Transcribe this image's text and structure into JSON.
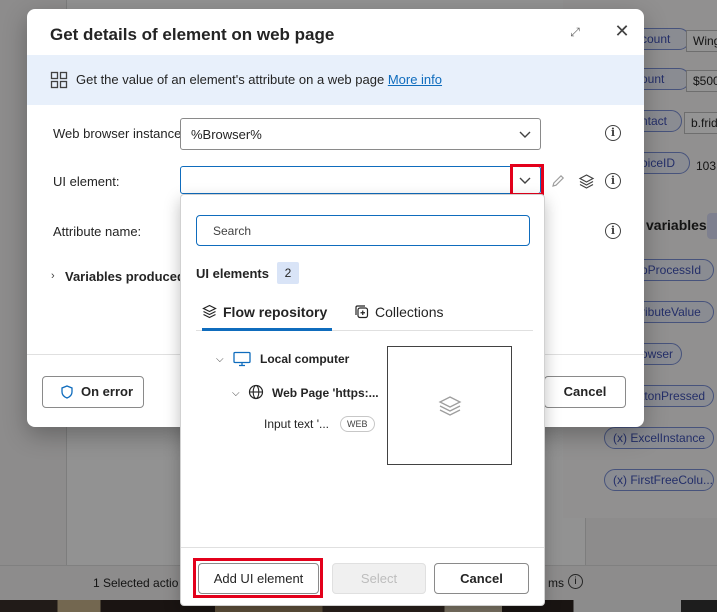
{
  "dialog": {
    "title": "Get details of element on web page",
    "banner_text": "Get the value of an element's attribute on a web page",
    "banner_link": "More info",
    "fields": {
      "browser_label": "Web browser instance:",
      "browser_value": "%Browser%",
      "ui_element_label": "UI element:",
      "ui_element_value": "",
      "attribute_label": "Attribute name:"
    },
    "variables_produced": "Variables produced",
    "on_error_label": "On error",
    "cancel_label": "Cancel"
  },
  "popup": {
    "search_placeholder": "Search",
    "ui_elements_title": "UI elements",
    "ui_elements_count": "2",
    "tabs": [
      "Flow repository",
      "Collections"
    ],
    "tree": {
      "root": "Local computer",
      "page": "Web Page 'https:...",
      "element": "Input text '...",
      "element_tag": "WEB"
    },
    "buttons": {
      "add": "Add UI element",
      "select": "Select",
      "cancel": "Cancel"
    }
  },
  "background": {
    "chips": [
      "count",
      "ount",
      "ntact",
      "oiceID",
      "pProcessId",
      "ributeValue",
      "owser",
      "ttonPressed",
      "ExcelInstance",
      "FirstFreeColu..."
    ],
    "values": [
      "Wing",
      "$500",
      "b.frid",
      "103"
    ],
    "variables_title": "variables",
    "status_text": "1 Selected actio",
    "status_text2": "ms",
    "status_info": "i"
  },
  "colors": {
    "accent": "#0f6cbd",
    "highlight": "#e3001b",
    "banner_bg": "#e8f0fb"
  }
}
